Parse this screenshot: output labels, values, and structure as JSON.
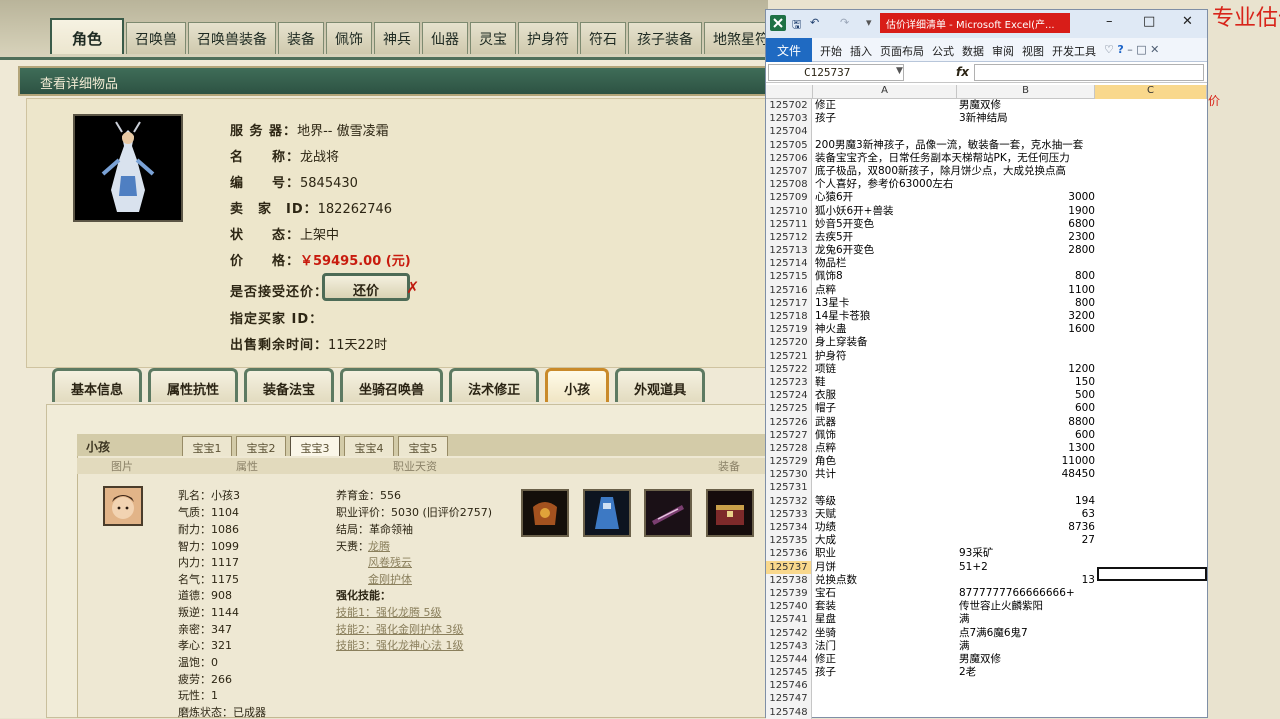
{
  "game": {
    "tabs": [
      "角色",
      "召唤兽",
      "召唤兽装备",
      "装备",
      "佩饰",
      "神兵",
      "仙器",
      "灵宝",
      "护身符",
      "符石",
      "孩子装备",
      "地煞星符"
    ],
    "section_bar": "查看详细物品",
    "info": {
      "server_label": "服 务 器：",
      "server": "地界-- 傲雪凌霜",
      "name_label": "名　　称：",
      "name": "龙战将",
      "id_label": "编　　号：",
      "id": "5845430",
      "seller_label": "卖　家　ID：",
      "seller": "182262746",
      "status_label": "状　　态：",
      "status": "上架中",
      "price_label": "价　　格：",
      "price": "￥59495.00 (元)",
      "haggle_label": "是否接受还价：",
      "haggle_button": "还价",
      "buyer_label": "指定买家 ID：",
      "time_label": "出售剩余时间：",
      "time": "11天22时"
    },
    "detail_tabs": [
      "基本信息",
      "属性抗性",
      "装备法宝",
      "坐骑召唤兽",
      "法术修正",
      "小孩",
      "外观道具"
    ],
    "child": {
      "header": "小孩",
      "baby_tabs": [
        "宝宝1",
        "宝宝2",
        "宝宝3",
        "宝宝4",
        "宝宝5"
      ],
      "cols": [
        "图片",
        "属性",
        "职业天资",
        "装备"
      ],
      "stats": [
        "乳名：小孩3",
        "气质：1104",
        "耐力：1086",
        "智力：1099",
        "内力：1117",
        "名气：1175",
        "道德：908",
        "叛逆：1144",
        "亲密：347",
        "孝心：321",
        "温饱：0",
        "疲劳：266",
        "玩性：1",
        "磨炼状态：已成器"
      ],
      "career": [
        "养育金：556",
        "职业评价：5030 (旧评价2757)",
        "结局：革命领袖",
        "天赉："
      ],
      "talents": [
        "龙腾",
        "风卷残云",
        "金刚护体"
      ],
      "skills_label": "强化技能：",
      "skills": [
        "技能1：强化龙腾 5级",
        "技能2：强化金刚护体 3级",
        "技能3：强化龙神心法 1级"
      ]
    }
  },
  "excel": {
    "title": "估价详细清单 - Microsoft Excel(产...",
    "ribbon": [
      "文件",
      "开始",
      "插入",
      "页面布局",
      "公式",
      "数据",
      "审阅",
      "视图",
      "开发工具"
    ],
    "namebox": "C125737",
    "columns": [
      "A",
      "B",
      "C"
    ],
    "rows": [
      [
        "125702",
        "修正",
        "男魔双修"
      ],
      [
        "125703",
        "孩子",
        "3新神结局"
      ],
      [
        "125704",
        "",
        ""
      ],
      [
        "125705",
        "200男魔3新神孩子，品像一流，敏装备一套，克水抽一套",
        ""
      ],
      [
        "125706",
        "装备宝宝齐全，日常任务副本天梯帮站PK，无任何压力",
        ""
      ],
      [
        "125707",
        "底子极品，双800新孩子，除月饼少点，大成兑换点高",
        ""
      ],
      [
        "125708",
        "个人喜好，参考价63000左右",
        ""
      ],
      [
        "125709",
        "心猿6开",
        "3000"
      ],
      [
        "125710",
        "狐小妖6开+兽装",
        "1900"
      ],
      [
        "125711",
        "妙音5开变色",
        "6800"
      ],
      [
        "125712",
        "去疾5开",
        "2300"
      ],
      [
        "125713",
        "龙兔6开变色",
        "2800"
      ],
      [
        "125714",
        "物品栏",
        ""
      ],
      [
        "125715",
        "佩饰8",
        "800"
      ],
      [
        "125716",
        "点粹",
        "1100"
      ],
      [
        "125717",
        "13星卡",
        "800"
      ],
      [
        "125718",
        "14星卡苍狼",
        "3200"
      ],
      [
        "125719",
        "神火蛊",
        "1600"
      ],
      [
        "125720",
        "身上穿装备",
        ""
      ],
      [
        "125721",
        "护身符",
        ""
      ],
      [
        "125722",
        "项链",
        "1200"
      ],
      [
        "125723",
        "鞋",
        "150"
      ],
      [
        "125724",
        "衣服",
        "500"
      ],
      [
        "125725",
        "帽子",
        "600"
      ],
      [
        "125726",
        "武器",
        "8800"
      ],
      [
        "125727",
        "佩饰",
        "600"
      ],
      [
        "125728",
        "点粹",
        "1300"
      ],
      [
        "125729",
        "角色",
        "11000"
      ],
      [
        "125730",
        "共计",
        "48450"
      ],
      [
        "125731",
        "",
        ""
      ],
      [
        "125732",
        "等级",
        "194"
      ],
      [
        "125733",
        "天赋",
        "63"
      ],
      [
        "125734",
        "功绩",
        "8736"
      ],
      [
        "125735",
        "大成",
        "27"
      ],
      [
        "125736",
        "职业",
        "93采矿"
      ],
      [
        "125737",
        "月饼",
        "51+2"
      ],
      [
        "125738",
        "兑换点数",
        "13"
      ],
      [
        "125739",
        "宝石",
        "8777777766666666+"
      ],
      [
        "125740",
        "套装",
        "传世容止火麟紫阳"
      ],
      [
        "125741",
        "星盘",
        "满"
      ],
      [
        "125742",
        "坐骑",
        "点7满6魔6鬼7"
      ],
      [
        "125743",
        "法门",
        "满"
      ],
      [
        "125744",
        "修正",
        "男魔双修"
      ],
      [
        "125745",
        "孩子",
        "2老"
      ],
      [
        "125746",
        "",
        ""
      ],
      [
        "125747",
        "",
        ""
      ],
      [
        "125748",
        "",
        ""
      ]
    ]
  },
  "background": {
    "title_fragment": "专业估价-配装",
    "price_fragment": "价"
  }
}
